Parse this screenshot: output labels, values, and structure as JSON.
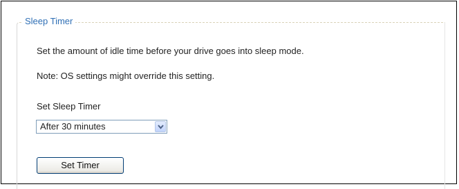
{
  "section": {
    "legend": "Sleep Timer",
    "description": "Set the amount of idle time before your drive goes into sleep mode.",
    "note": "Note: OS settings might override this setting."
  },
  "form": {
    "field_label": "Set Sleep Timer",
    "select_value": "After 30 minutes",
    "button_label": "Set Timer"
  },
  "icons": {
    "select_arrow": "chevron-down-icon"
  },
  "colors": {
    "legend": "#2f6fb5",
    "select_border": "#7f9db9",
    "button_border": "#003c74"
  }
}
